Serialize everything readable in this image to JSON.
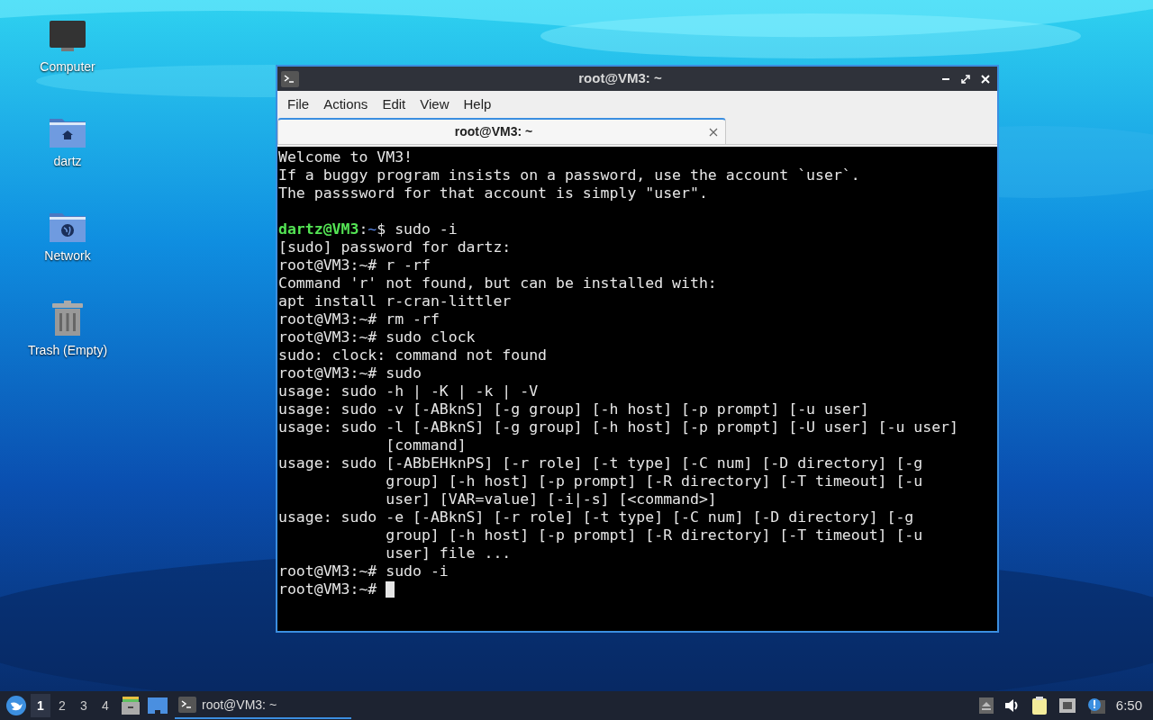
{
  "desktop_icons": [
    {
      "kind": "computer",
      "label": "Computer"
    },
    {
      "kind": "home",
      "label": "dartz"
    },
    {
      "kind": "network",
      "label": "Network"
    },
    {
      "kind": "trash",
      "label": "Trash (Empty)"
    }
  ],
  "window": {
    "title": "root@VM3: ~",
    "menu": [
      "File",
      "Actions",
      "Edit",
      "View",
      "Help"
    ],
    "tabs": [
      {
        "label": "root@VM3: ~",
        "selected": true
      }
    ],
    "terminal": {
      "cursor_visible": true,
      "lines": [
        {
          "kind": "plain",
          "text": "Welcome to VM3!"
        },
        {
          "kind": "plain",
          "text": "If a buggy program insists on a password, use the account `user`."
        },
        {
          "kind": "plain",
          "text": "The passsword for that account is simply \"user\"."
        },
        {
          "kind": "blank"
        },
        {
          "kind": "prompt",
          "user": "dartz@VM3",
          "sep": ":",
          "path": "~",
          "command": "$ sudo -i"
        },
        {
          "kind": "plain",
          "text": "[sudo] password for dartz:"
        },
        {
          "kind": "plain",
          "text": "root@VM3:~# r -rf"
        },
        {
          "kind": "plain",
          "text": "Command 'r' not found, but can be installed with:"
        },
        {
          "kind": "plain",
          "text": "apt install r-cran-littler"
        },
        {
          "kind": "plain",
          "text": "root@VM3:~# rm -rf"
        },
        {
          "kind": "plain",
          "text": "root@VM3:~# sudo clock"
        },
        {
          "kind": "plain",
          "text": "sudo: clock: command not found"
        },
        {
          "kind": "plain",
          "text": "root@VM3:~# sudo"
        },
        {
          "kind": "plain",
          "text": "usage: sudo -h | -K | -k | -V"
        },
        {
          "kind": "plain",
          "text": "usage: sudo -v [-ABknS] [-g group] [-h host] [-p prompt] [-u user]"
        },
        {
          "kind": "plain",
          "text": "usage: sudo -l [-ABknS] [-g group] [-h host] [-p prompt] [-U user] [-u user]"
        },
        {
          "kind": "wrap",
          "text": "[command]"
        },
        {
          "kind": "plain",
          "text": "usage: sudo [-ABbEHknPS] [-r role] [-t type] [-C num] [-D directory] [-g"
        },
        {
          "kind": "wrap",
          "text": "group] [-h host] [-p prompt] [-R directory] [-T timeout] [-u"
        },
        {
          "kind": "wrap",
          "text": "user] [VAR=value] [-i|-s] [<command>]"
        },
        {
          "kind": "plain",
          "text": "usage: sudo -e [-ABknS] [-r role] [-t type] [-C num] [-D directory] [-g"
        },
        {
          "kind": "wrap",
          "text": "group] [-h host] [-p prompt] [-R directory] [-T timeout] [-u"
        },
        {
          "kind": "wrap",
          "text": "user] file ..."
        },
        {
          "kind": "plain",
          "text": "root@VM3:~# sudo -i"
        },
        {
          "kind": "plain",
          "text": "root@VM3:~#"
        }
      ]
    }
  },
  "taskbar": {
    "workspaces": [
      {
        "label": "1",
        "selected": true
      },
      {
        "label": "2",
        "selected": false
      },
      {
        "label": "3",
        "selected": false
      },
      {
        "label": "4",
        "selected": false
      }
    ],
    "tasks": [
      {
        "label": "root@VM3: ~",
        "selected": true
      }
    ],
    "clock": "6:50"
  }
}
